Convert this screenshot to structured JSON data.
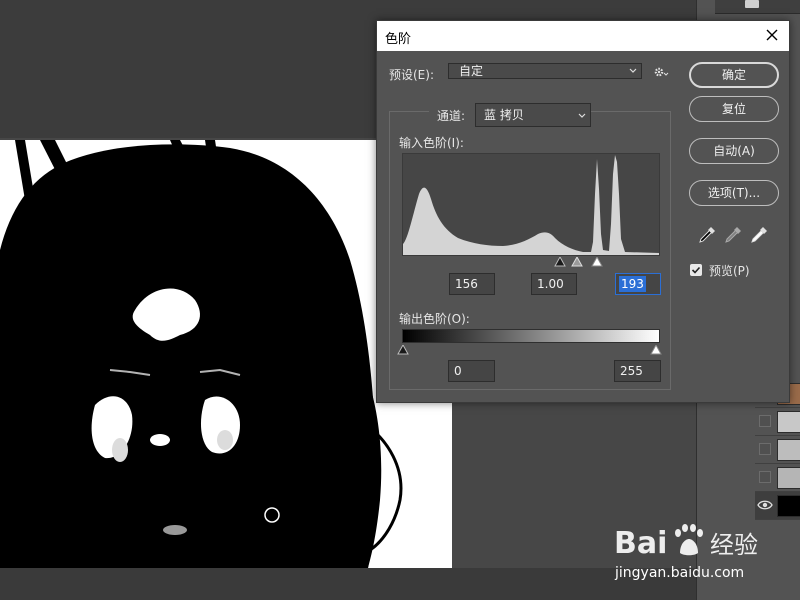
{
  "dialog": {
    "title": "色阶",
    "preset_label": "预设(E):",
    "preset_value": "自定",
    "channel_label": "通道:",
    "channel_value": "蓝 拷贝",
    "input_levels_label": "输入色阶(I):",
    "input_shadow": "156",
    "input_midtone": "1.00",
    "input_highlight": "193",
    "output_levels_label": "输出色阶(O):",
    "output_shadow": "0",
    "output_highlight": "255",
    "buttons": {
      "ok": "确定",
      "reset": "复位",
      "auto": "自动(A)",
      "options": "选项(T)..."
    },
    "preview_label": "预览(P)",
    "preview_checked": true
  },
  "histogram": {
    "input_shadow_fraction": 0.612,
    "input_midtone_fraction": 0.677,
    "input_highlight_fraction": 0.757
  },
  "watermark": {
    "logo_text": "Bai 经验",
    "url": "jingyan.baidu.com"
  },
  "icons": {
    "close": "close-icon",
    "gear": "gear-icon",
    "eyedroppers": [
      "black-point-eyedropper-icon",
      "gray-point-eyedropper-icon",
      "white-point-eyedropper-icon"
    ],
    "eye": "eye-icon"
  },
  "colors": {
    "dialog_bg": "#535353",
    "workspace_bg": "#474747",
    "highlight_blue": "#2b6fd6"
  }
}
